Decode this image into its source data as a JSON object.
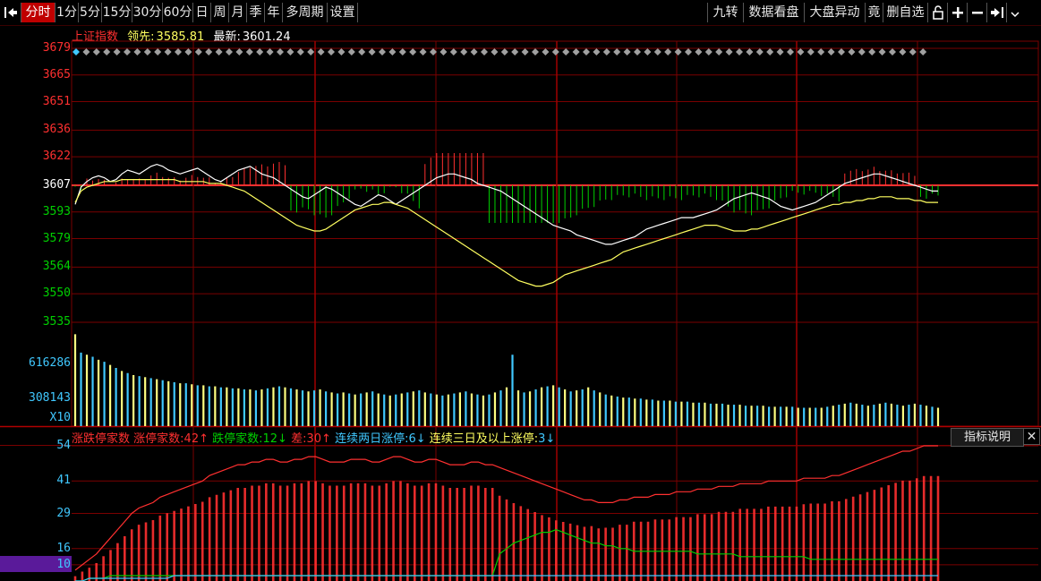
{
  "toolbar": {
    "left_icon": "dock-left-icon",
    "tabs": [
      "分时",
      "1分",
      "5分",
      "15分",
      "30分",
      "60分",
      "日",
      "周",
      "月",
      "季",
      "年",
      "多周期",
      "设置"
    ],
    "active_tab": "分时",
    "right_buttons": [
      "九转",
      "数据看盘",
      "大盘异动",
      "竟",
      "删自选"
    ],
    "right_icons": [
      "lock-icon",
      "plus-icon",
      "minus-icon",
      "dock-right-icon",
      "chevron-down-icon"
    ]
  },
  "price_panel": {
    "index_name": "上证指数",
    "leader_label": "领先:",
    "leader_value": "3585.81",
    "latest_label": "最新:",
    "latest_value": "3601.24"
  },
  "volume_panel": {
    "multiplier_label": "X10"
  },
  "lower_panel": {
    "title": "涨跌停家数",
    "limit_up_label": "涨停家数:",
    "limit_up_value": "42↑",
    "limit_down_label": "跌停家数:",
    "limit_down_value": "12↓",
    "diff_label": "差:",
    "diff_value": "30↑",
    "two_day_label": "连续两日涨停:",
    "two_day_value": "6↓",
    "three_day_label": "连续三日及以上涨停:",
    "three_day_value": "3↓",
    "indicator_button": "指标说明",
    "close_symbol": "✕"
  },
  "colors": {
    "up": "#ff3030",
    "down": "#00d000",
    "price_line": "#ffffff",
    "avg_line": "#ffff60",
    "grid": "#7a0000",
    "volume_up": "#ffff80",
    "volume_down": "#40c8ff"
  },
  "chart_data": [
    {
      "type": "line",
      "name": "intraday-price",
      "ylim": [
        3535,
        3679
      ],
      "y_ticks": [
        "3679",
        "3665",
        "3651",
        "3636",
        "3622",
        "3607",
        "3593",
        "3579",
        "3564",
        "3550",
        "3535"
      ],
      "prev_close": 3607,
      "series": [
        {
          "name": "price",
          "values": [
            3597,
            3606,
            3609,
            3611,
            3612,
            3611,
            3609,
            3610,
            3613,
            3615,
            3614,
            3613,
            3615,
            3617,
            3618,
            3617,
            3615,
            3614,
            3613,
            3614,
            3615,
            3616,
            3614,
            3612,
            3610,
            3609,
            3611,
            3613,
            3615,
            3616,
            3617,
            3615,
            3613,
            3612,
            3611,
            3609,
            3607,
            3605,
            3603,
            3601,
            3600,
            3602,
            3604,
            3606,
            3605,
            3603,
            3601,
            3599,
            3597,
            3596,
            3598,
            3600,
            3602,
            3601,
            3599,
            3597,
            3599,
            3601,
            3603,
            3605,
            3607,
            3609,
            3611,
            3612,
            3613,
            3613,
            3612,
            3611,
            3610,
            3608,
            3607,
            3606,
            3605,
            3604,
            3602,
            3600,
            3598,
            3596,
            3594,
            3592,
            3590,
            3588,
            3586,
            3585,
            3584,
            3583,
            3581,
            3580,
            3579,
            3578,
            3577,
            3576,
            3576,
            3577,
            3578,
            3579,
            3580,
            3582,
            3584,
            3585,
            3586,
            3587,
            3588,
            3589,
            3590,
            3590,
            3590,
            3591,
            3592,
            3593,
            3594,
            3596,
            3598,
            3600,
            3601,
            3602,
            3603,
            3602,
            3601,
            3600,
            3598,
            3596,
            3595,
            3594,
            3595,
            3596,
            3597,
            3598,
            3600,
            3602,
            3604,
            3606,
            3608,
            3609,
            3610,
            3611,
            3612,
            3613,
            3613,
            3612,
            3611,
            3610,
            3609,
            3608,
            3607,
            3606,
            3605,
            3604,
            3604
          ]
        },
        {
          "name": "average",
          "values": [
            3598,
            3604,
            3606,
            3607,
            3608,
            3609,
            3609,
            3609,
            3610,
            3610,
            3610,
            3610,
            3610,
            3610,
            3610,
            3610,
            3610,
            3610,
            3609,
            3609,
            3609,
            3609,
            3609,
            3608,
            3608,
            3608,
            3607,
            3606,
            3605,
            3604,
            3602,
            3600,
            3598,
            3596,
            3594,
            3592,
            3590,
            3588,
            3586,
            3585,
            3584,
            3583,
            3583,
            3584,
            3586,
            3588,
            3590,
            3592,
            3594,
            3595,
            3596,
            3597,
            3597,
            3598,
            3598,
            3597,
            3596,
            3595,
            3593,
            3591,
            3589,
            3587,
            3585,
            3583,
            3581,
            3579,
            3577,
            3575,
            3573,
            3571,
            3569,
            3567,
            3565,
            3563,
            3561,
            3559,
            3557,
            3556,
            3555,
            3554,
            3554,
            3555,
            3556,
            3558,
            3560,
            3561,
            3562,
            3563,
            3564,
            3565,
            3566,
            3567,
            3568,
            3570,
            3572,
            3573,
            3574,
            3575,
            3576,
            3577,
            3578,
            3579,
            3580,
            3581,
            3582,
            3583,
            3584,
            3585,
            3586,
            3586,
            3586,
            3585,
            3584,
            3583,
            3583,
            3583,
            3584,
            3584,
            3585,
            3586,
            3587,
            3588,
            3589,
            3590,
            3591,
            3592,
            3593,
            3594,
            3595,
            3596,
            3597,
            3597,
            3598,
            3598,
            3599,
            3599,
            3600,
            3600,
            3601,
            3601,
            3601,
            3600,
            3600,
            3600,
            3599,
            3599,
            3598,
            3598,
            3598
          ]
        }
      ]
    },
    {
      "type": "bar",
      "name": "volume",
      "y_ticks": [
        "616286",
        "308143"
      ],
      "values": [
        9,
        7.2,
        7.0,
        6.8,
        6.5,
        6.3,
        6.0,
        5.7,
        5.4,
        5.2,
        5.0,
        4.9,
        4.8,
        4.7,
        4.6,
        4.5,
        4.4,
        4.3,
        4.2,
        4.2,
        4.1,
        4.0,
        4.0,
        3.9,
        3.9,
        3.8,
        3.8,
        3.7,
        3.7,
        3.6,
        3.6,
        3.5,
        3.6,
        3.7,
        3.8,
        3.9,
        3.8,
        3.7,
        3.6,
        3.5,
        3.4,
        3.5,
        3.6,
        3.4,
        3.3,
        3.2,
        3.3,
        3.2,
        3.1,
        3.2,
        3.3,
        3.4,
        3.2,
        3.1,
        3.0,
        3.1,
        3.2,
        3.3,
        3.4,
        3.5,
        3.3,
        3.2,
        3.1,
        3.0,
        3.1,
        3.2,
        3.3,
        3.4,
        3.2,
        3.1,
        3.0,
        3.1,
        3.3,
        3.5,
        3.8,
        7.0,
        3.5,
        3.3,
        3.4,
        3.6,
        3.8,
        3.9,
        4.0,
        3.8,
        3.6,
        3.4,
        3.5,
        3.6,
        3.8,
        3.5,
        3.3,
        3.1,
        3.0,
        2.9,
        2.8,
        2.8,
        2.7,
        2.7,
        2.6,
        2.6,
        2.5,
        2.5,
        2.5,
        2.4,
        2.4,
        2.4,
        2.3,
        2.3,
        2.3,
        2.2,
        2.2,
        2.2,
        2.1,
        2.1,
        2.1,
        2.0,
        2.0,
        2.0,
        2.0,
        1.9,
        1.9,
        1.9,
        1.9,
        1.9,
        1.8,
        1.8,
        1.8,
        1.8,
        1.8,
        1.9,
        2.0,
        2.1,
        2.2,
        2.3,
        2.2,
        2.1,
        2.0,
        2.1,
        2.2,
        2.3,
        2.2,
        2.1,
        2.0,
        2.1,
        2.2,
        2.1,
        2.0,
        1.9,
        1.8
      ]
    },
    {
      "type": "line",
      "name": "limit-up-down-count",
      "ylim": [
        4,
        54
      ],
      "y_ticks": [
        "54",
        "41",
        "29",
        "16",
        "10"
      ],
      "series": [
        {
          "name": "涨停家数",
          "values": [
            8,
            10,
            12,
            14,
            17,
            20,
            23,
            26,
            29,
            31,
            32,
            33,
            35,
            36,
            37,
            38,
            39,
            40,
            41,
            43,
            44,
            45,
            46,
            47,
            47,
            48,
            48,
            49,
            49,
            48,
            48,
            49,
            49,
            50,
            50,
            49,
            48,
            48,
            48,
            49,
            49,
            49,
            48,
            48,
            49,
            50,
            50,
            49,
            48,
            48,
            49,
            49,
            48,
            47,
            47,
            47,
            48,
            48,
            47,
            47,
            46,
            45,
            44,
            43,
            42,
            41,
            40,
            39,
            38,
            37,
            36,
            35,
            34,
            34,
            33,
            33,
            33,
            34,
            34,
            35,
            35,
            35,
            36,
            36,
            36,
            37,
            37,
            37,
            38,
            38,
            38,
            39,
            39,
            39,
            40,
            40,
            40,
            40,
            41,
            41,
            41,
            41,
            41,
            42,
            42,
            42,
            42,
            43,
            43,
            44,
            45,
            46,
            47,
            48,
            49,
            50,
            51,
            52,
            52,
            53,
            54,
            54,
            54
          ]
        },
        {
          "name": "跌停家数",
          "values": [
            4,
            4,
            5,
            5,
            5,
            6,
            6,
            6,
            6,
            6,
            6,
            6,
            6,
            6,
            6,
            6,
            6,
            6,
            6,
            6,
            6,
            6,
            6,
            6,
            6,
            6,
            6,
            6,
            6,
            6,
            6,
            6,
            6,
            6,
            6,
            6,
            6,
            6,
            6,
            6,
            6,
            6,
            6,
            6,
            6,
            6,
            6,
            6,
            6,
            6,
            6,
            6,
            6,
            6,
            6,
            6,
            6,
            6,
            6,
            6,
            14,
            16,
            18,
            19,
            20,
            21,
            22,
            22,
            23,
            22,
            21,
            20,
            19,
            18,
            18,
            17,
            17,
            16,
            16,
            15,
            15,
            15,
            15,
            15,
            15,
            15,
            15,
            15,
            14,
            14,
            14,
            14,
            14,
            14,
            13,
            13,
            13,
            13,
            13,
            13,
            13,
            13,
            13,
            13,
            12,
            12,
            12,
            12,
            12,
            12,
            12,
            12,
            12,
            12,
            12,
            12,
            12,
            12,
            12,
            12,
            12,
            12,
            12
          ]
        },
        {
          "name": "连续两日涨停",
          "values": [
            4,
            4,
            5,
            5,
            5,
            5,
            5,
            5,
            5,
            5,
            5,
            5,
            5,
            5,
            6,
            6,
            6,
            6,
            6,
            6,
            6,
            6,
            6,
            6,
            6,
            6,
            6,
            6,
            6,
            6,
            6,
            6,
            6,
            6,
            6,
            6,
            6,
            6,
            6,
            6,
            6,
            6,
            6,
            6,
            6,
            6,
            6,
            6,
            6,
            6,
            6,
            6,
            6,
            6,
            6,
            6,
            6,
            6,
            6,
            6,
            6,
            6,
            6,
            6,
            6,
            6,
            6,
            6,
            6,
            6,
            6,
            6,
            6,
            6,
            6,
            6,
            6,
            6,
            6,
            6,
            6,
            6,
            6,
            6,
            6,
            6,
            6,
            6,
            6,
            6,
            6,
            6,
            6,
            6,
            6,
            6,
            6,
            6,
            6,
            6,
            6,
            6,
            6,
            6,
            6,
            6,
            6,
            6,
            6,
            6,
            6,
            6,
            6,
            6,
            6,
            6,
            6,
            6,
            6,
            6,
            6,
            6,
            6
          ]
        },
        {
          "name": "连续三日及以上涨停",
          "values": [
            3,
            3,
            3,
            3,
            3,
            3,
            3,
            3,
            3,
            3,
            3,
            3,
            3,
            3,
            3,
            3,
            3,
            3,
            3,
            3,
            3,
            3,
            3,
            3,
            3,
            3,
            3,
            3,
            3,
            3,
            3,
            3,
            3,
            3,
            3,
            3,
            3,
            3,
            3,
            3,
            3,
            3,
            3,
            3,
            3,
            3,
            3,
            3,
            3,
            3,
            3,
            3,
            3,
            3,
            3,
            3,
            3,
            3,
            3,
            3,
            3,
            3,
            3,
            3,
            3,
            3,
            3,
            3,
            3,
            3,
            3,
            3,
            3,
            3,
            3,
            3,
            3,
            3,
            3,
            3,
            3,
            3,
            3,
            3,
            3,
            3,
            3,
            3,
            3,
            3,
            3,
            3,
            3,
            3,
            3,
            3,
            3,
            3,
            3,
            3,
            3,
            3,
            3,
            3,
            3,
            3,
            3,
            3,
            3,
            3,
            3,
            3,
            3,
            3,
            3,
            3,
            3,
            3,
            3,
            3,
            3,
            3,
            3
          ]
        }
      ]
    }
  ]
}
